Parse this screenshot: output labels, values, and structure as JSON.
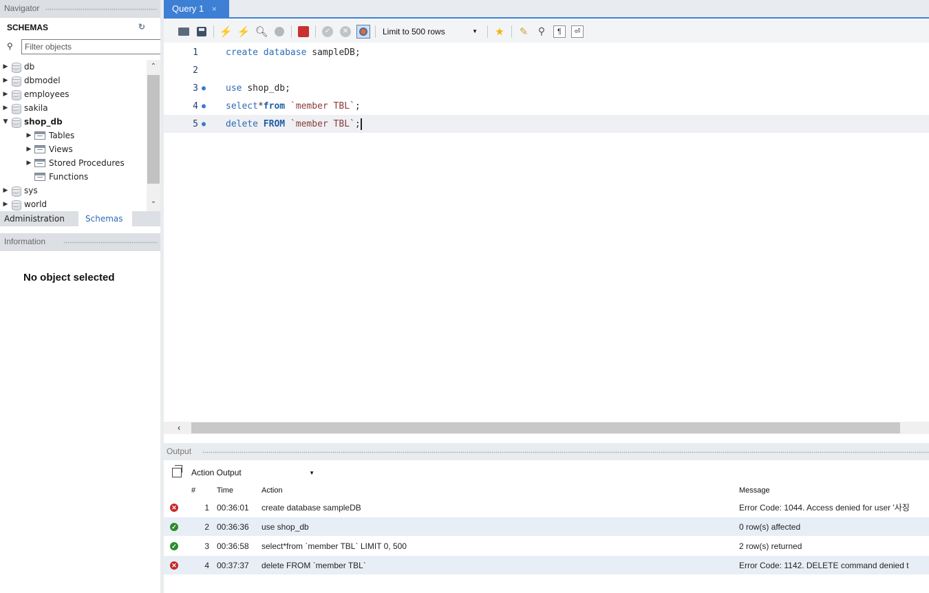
{
  "navigator": {
    "header": "Navigator",
    "schemas_title": "SCHEMAS",
    "filter_placeholder": "Filter objects",
    "tree": [
      {
        "label": "db",
        "expanded": false
      },
      {
        "label": "dbmodel",
        "expanded": false
      },
      {
        "label": "employees",
        "expanded": false
      },
      {
        "label": "sakila",
        "expanded": false
      },
      {
        "label": "shop_db",
        "expanded": true,
        "bold": true
      },
      {
        "label": "Tables",
        "child": true
      },
      {
        "label": "Views",
        "child": true
      },
      {
        "label": "Stored Procedures",
        "child": true
      },
      {
        "label": "Functions",
        "child": true
      },
      {
        "label": "sys",
        "expanded": false
      },
      {
        "label": "world",
        "expanded": false
      }
    ],
    "tabs": {
      "administration": "Administration",
      "schemas": "Schemas"
    }
  },
  "information": {
    "header": "Information",
    "empty_text": "No object selected"
  },
  "editor": {
    "tab_label": "Query 1",
    "tab_close": "×",
    "limit_label": "Limit to 500 rows",
    "lines": [
      {
        "n": "1",
        "marker": "",
        "tokens": [
          {
            "t": "create database ",
            "c": "kw"
          },
          {
            "t": "sampleDB;",
            "c": "txt"
          }
        ]
      },
      {
        "n": "2",
        "marker": "",
        "tokens": []
      },
      {
        "n": "3",
        "marker": "●",
        "tokens": [
          {
            "t": "use ",
            "c": "kw"
          },
          {
            "t": "shop_db;",
            "c": "txt"
          }
        ]
      },
      {
        "n": "4",
        "marker": "●",
        "tokens": [
          {
            "t": "select",
            "c": "kw"
          },
          {
            "t": "*",
            "c": "txt"
          },
          {
            "t": "from ",
            "c": "kwb"
          },
          {
            "t": "`member TBL`",
            "c": "str"
          },
          {
            "t": ";",
            "c": "txt"
          }
        ]
      },
      {
        "n": "5",
        "marker": "●",
        "tokens": [
          {
            "t": "delete ",
            "c": "kw"
          },
          {
            "t": "FROM ",
            "c": "kwb"
          },
          {
            "t": "`member TBL`",
            "c": "str"
          },
          {
            "t": ";",
            "c": "txt"
          }
        ],
        "current": true
      }
    ]
  },
  "output": {
    "header": "Output",
    "mode": "Action Output",
    "columns": {
      "num": "#",
      "time": "Time",
      "action": "Action",
      "message": "Message"
    },
    "rows": [
      {
        "status": "error",
        "num": "1",
        "time": "00:36:01",
        "action": "create database sampleDB",
        "message": "Error Code: 1044. Access denied for user '사징"
      },
      {
        "status": "ok",
        "num": "2",
        "time": "00:36:36",
        "action": "use shop_db",
        "message": "0 row(s) affected"
      },
      {
        "status": "ok",
        "num": "3",
        "time": "00:36:58",
        "action": "select*from `member TBL` LIMIT 0, 500",
        "message": "2 row(s) returned"
      },
      {
        "status": "error",
        "num": "4",
        "time": "00:37:37",
        "action": "delete FROM `member TBL`",
        "message": "Error Code: 1142. DELETE command denied t"
      }
    ]
  },
  "colors": {
    "accent": "#3d7fd4",
    "error": "#c62828",
    "ok": "#2e8b2e"
  }
}
